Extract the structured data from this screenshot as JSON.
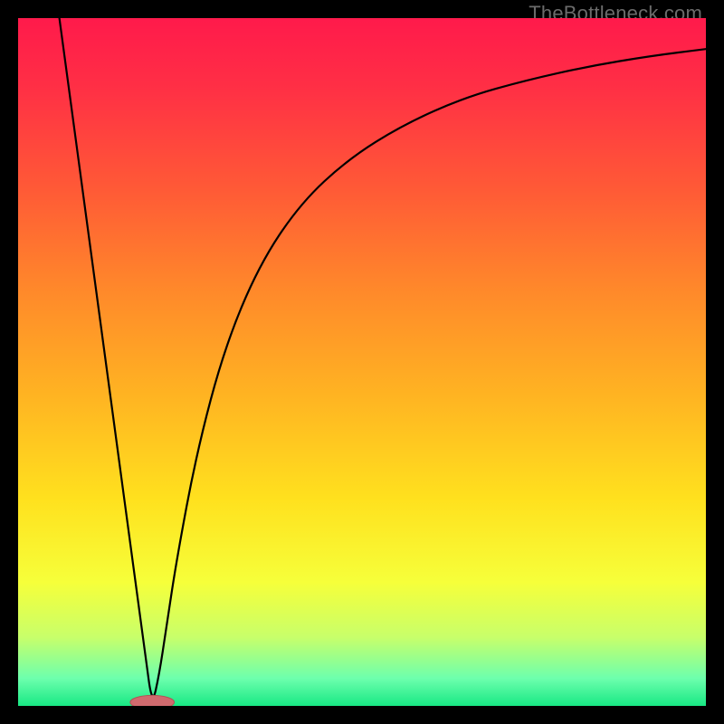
{
  "watermark": "TheBottleneck.com",
  "colors": {
    "frame": "#000000",
    "curve": "#000000",
    "marker_fill": "#d06a6e",
    "marker_stroke": "#b35357",
    "gradient_stops": [
      {
        "offset": 0.0,
        "color": "#ff1a4b"
      },
      {
        "offset": 0.1,
        "color": "#ff2f45"
      },
      {
        "offset": 0.25,
        "color": "#ff5a36"
      },
      {
        "offset": 0.4,
        "color": "#ff8a2a"
      },
      {
        "offset": 0.55,
        "color": "#ffb422"
      },
      {
        "offset": 0.7,
        "color": "#ffe11e"
      },
      {
        "offset": 0.82,
        "color": "#f6ff3a"
      },
      {
        "offset": 0.9,
        "color": "#c8ff6a"
      },
      {
        "offset": 0.96,
        "color": "#6dffad"
      },
      {
        "offset": 1.0,
        "color": "#18e884"
      }
    ]
  },
  "chart_data": {
    "type": "line",
    "title": "",
    "xlabel": "",
    "ylabel": "",
    "xlim": [
      0,
      1
    ],
    "ylim": [
      0,
      1
    ],
    "grid": false,
    "legend": false,
    "notes": "Axes are unlabeled; values are normalized 0–1. The curve is a V-shaped bottleneck with a minimum near x≈0.195 and an asymptotic rise to the right. Background is a vertical red→green gradient.",
    "series": [
      {
        "name": "bottleneck-curve",
        "x": [
          0.06,
          0.1,
          0.14,
          0.17,
          0.185,
          0.195,
          0.205,
          0.215,
          0.23,
          0.26,
          0.3,
          0.35,
          0.41,
          0.48,
          0.56,
          0.65,
          0.74,
          0.83,
          0.92,
          1.0
        ],
        "y": [
          1.0,
          0.704,
          0.407,
          0.185,
          0.074,
          0.0,
          0.045,
          0.11,
          0.21,
          0.37,
          0.52,
          0.64,
          0.73,
          0.795,
          0.845,
          0.885,
          0.91,
          0.93,
          0.945,
          0.955
        ]
      }
    ],
    "marker": {
      "x": 0.195,
      "y": 0.0,
      "rx": 0.032,
      "ry": 0.01
    }
  }
}
